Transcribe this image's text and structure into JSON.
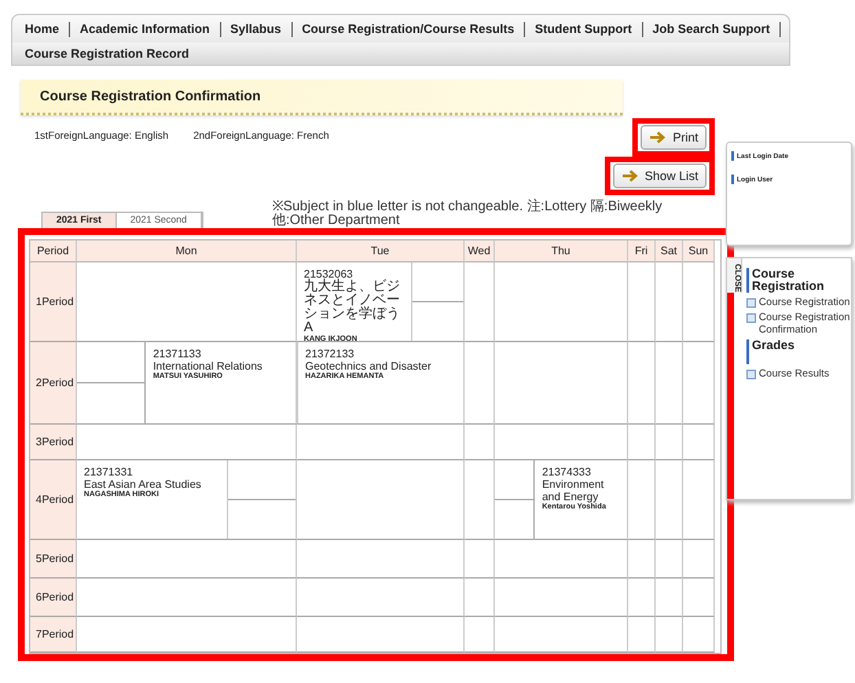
{
  "nav": {
    "items": [
      "Home",
      "Academic Information",
      "Syllabus",
      "Course Registration/Course Results",
      "Student Support",
      "Job Search Support"
    ],
    "sub_items": [
      "Course Registration Record"
    ]
  },
  "page_title": "Course Registration Confirmation",
  "languages": [
    "1stForeignLanguage: English",
    "2ndForeignLanguage: French"
  ],
  "buttons": [
    {
      "label": "Print",
      "highlighted": true
    },
    {
      "label": "Show List",
      "highlighted": true
    }
  ],
  "terms": [
    {
      "label": "2021 First",
      "selected": true
    },
    {
      "label": "2021 Second",
      "selected": false
    }
  ],
  "notice": "※Subject in blue letter is not changeable. 注:Lottery 隔:Biweekly 他:Other Department",
  "timetable": {
    "highlighted": true,
    "columns": [
      "Period",
      "Mon",
      "Tue",
      "Wed",
      "Thu",
      "Fri",
      "Sat",
      "Sun"
    ],
    "rows": [
      {
        "cells": [
          {
            "kind": "period",
            "text": "1Period"
          },
          {
            "kind": "day"
          },
          {
            "kind": "day",
            "slots": [
              {
                "kind": "course",
                "code": "21532063",
                "title": "九大生よ、ビジネスとイノベーションを学ぼうA",
                "teacher": "KANG IKJOON"
              },
              {
                "kind": "split"
              }
            ]
          },
          {
            "kind": "day"
          },
          {
            "kind": "day"
          },
          {
            "kind": "day"
          },
          {
            "kind": "day"
          },
          {
            "kind": "day"
          }
        ]
      },
      {
        "cells": [
          {
            "kind": "period",
            "text": "2Period"
          },
          {
            "kind": "day",
            "slots": [
              {
                "kind": "split"
              },
              {
                "kind": "course",
                "code": "21371133",
                "title": "International Relations",
                "teacher": "MATSUI YASUHIRO"
              }
            ]
          },
          {
            "kind": "day",
            "slots": [
              {
                "kind": "course",
                "code": "21372133",
                "title": "Geotechnics and Disaster",
                "teacher": "HAZARIKA HEMANTA"
              }
            ]
          },
          {
            "kind": "day"
          },
          {
            "kind": "day"
          },
          {
            "kind": "day"
          },
          {
            "kind": "day"
          },
          {
            "kind": "day"
          }
        ]
      },
      {
        "cells": [
          {
            "kind": "period",
            "text": "3Period"
          },
          {
            "kind": "day"
          },
          {
            "kind": "day"
          },
          {
            "kind": "day"
          },
          {
            "kind": "day"
          },
          {
            "kind": "day"
          },
          {
            "kind": "day"
          },
          {
            "kind": "day"
          }
        ]
      },
      {
        "cells": [
          {
            "kind": "period",
            "text": "4Period"
          },
          {
            "kind": "day",
            "slots": [
              {
                "kind": "course",
                "code": "21371331",
                "title": "East Asian Area Studies",
                "teacher": "NAGASHIMA HIROKI"
              },
              {
                "kind": "split"
              }
            ]
          },
          {
            "kind": "day"
          },
          {
            "kind": "day"
          },
          {
            "kind": "day",
            "slots": [
              {
                "kind": "split"
              },
              {
                "kind": "course",
                "code": "21374333",
                "title": "Environment and Energy",
                "teacher": "Kentarou Yoshida"
              }
            ]
          },
          {
            "kind": "day"
          },
          {
            "kind": "day"
          },
          {
            "kind": "day"
          }
        ]
      },
      {
        "cells": [
          {
            "kind": "period",
            "text": "5Period"
          },
          {
            "kind": "day"
          },
          {
            "kind": "day"
          },
          {
            "kind": "day"
          },
          {
            "kind": "day"
          },
          {
            "kind": "day"
          },
          {
            "kind": "day"
          },
          {
            "kind": "day"
          }
        ]
      },
      {
        "cells": [
          {
            "kind": "period",
            "text": "6Period"
          },
          {
            "kind": "day"
          },
          {
            "kind": "day"
          },
          {
            "kind": "day"
          },
          {
            "kind": "day"
          },
          {
            "kind": "day"
          },
          {
            "kind": "day"
          },
          {
            "kind": "day"
          }
        ]
      },
      {
        "cells": [
          {
            "kind": "period",
            "text": "7Period"
          },
          {
            "kind": "day"
          },
          {
            "kind": "day"
          },
          {
            "kind": "day"
          },
          {
            "kind": "day"
          },
          {
            "kind": "day"
          },
          {
            "kind": "day"
          },
          {
            "kind": "day"
          }
        ]
      }
    ]
  },
  "sidebar": {
    "info": [
      "Last Login Date",
      "Login User"
    ],
    "close_tab": "CLOSE",
    "sections": [
      {
        "heading": "Course Registration",
        "links": [
          "Course Registration",
          "Course Registration Confirmation"
        ]
      },
      {
        "heading": "Grades",
        "links": [
          "Course Results"
        ]
      }
    ]
  }
}
